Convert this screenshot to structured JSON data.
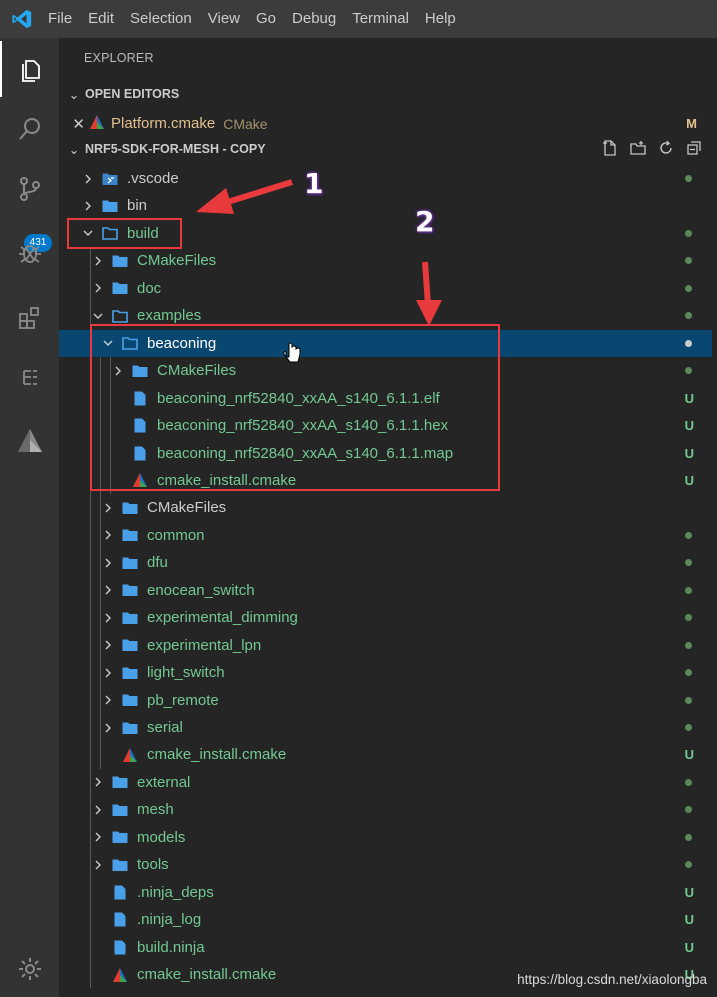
{
  "menu": [
    "File",
    "Edit",
    "Selection",
    "View",
    "Go",
    "Debug",
    "Terminal",
    "Help"
  ],
  "activity_bar": {
    "items": [
      "explorer-icon",
      "search-icon",
      "source-control-icon",
      "debug-icon",
      "extensions-icon",
      "tree-icon",
      "cmake-icon"
    ],
    "scm_badge": "431",
    "bottom": "gear-icon"
  },
  "sidebar": {
    "title": "EXPLORER",
    "open_editors": {
      "header": "OPEN EDITORS",
      "file": "Platform.cmake",
      "desc": "CMake",
      "mark": "M"
    },
    "project": {
      "header": "NRF5-SDK-FOR-MESH - COPY"
    },
    "tree": [
      {
        "label": ".vscode",
        "depth": 0,
        "type": "vsfolder",
        "expanded": false,
        "status": "dot"
      },
      {
        "label": "bin",
        "depth": 0,
        "type": "folder",
        "expanded": false,
        "status": ""
      },
      {
        "label": "build",
        "depth": 0,
        "type": "folder",
        "expanded": true,
        "status": "dot",
        "green": true
      },
      {
        "label": "CMakeFiles",
        "depth": 1,
        "type": "folder",
        "expanded": false,
        "status": "dot",
        "green": true
      },
      {
        "label": "doc",
        "depth": 1,
        "type": "folder",
        "expanded": false,
        "status": "dot",
        "green": true
      },
      {
        "label": "examples",
        "depth": 1,
        "type": "folder",
        "expanded": true,
        "status": "dot",
        "green": true
      },
      {
        "label": "beaconing",
        "depth": 2,
        "type": "folder",
        "expanded": true,
        "status": "dot",
        "selected": true
      },
      {
        "label": "CMakeFiles",
        "depth": 3,
        "type": "folder",
        "expanded": false,
        "status": "dot",
        "green": true
      },
      {
        "label": "beaconing_nrf52840_xxAA_s140_6.1.1.elf",
        "depth": 3,
        "type": "file",
        "status": "U",
        "green": true
      },
      {
        "label": "beaconing_nrf52840_xxAA_s140_6.1.1.hex",
        "depth": 3,
        "type": "file",
        "status": "U",
        "green": true
      },
      {
        "label": "beaconing_nrf52840_xxAA_s140_6.1.1.map",
        "depth": 3,
        "type": "file",
        "status": "U",
        "green": true
      },
      {
        "label": "cmake_install.cmake",
        "depth": 3,
        "type": "cmake",
        "status": "U",
        "green": true
      },
      {
        "label": "CMakeFiles",
        "depth": 2,
        "type": "folder",
        "expanded": false,
        "status": ""
      },
      {
        "label": "common",
        "depth": 2,
        "type": "folder",
        "expanded": false,
        "status": "dot",
        "green": true
      },
      {
        "label": "dfu",
        "depth": 2,
        "type": "folder",
        "expanded": false,
        "status": "dot",
        "green": true
      },
      {
        "label": "enocean_switch",
        "depth": 2,
        "type": "folder",
        "expanded": false,
        "status": "dot",
        "green": true
      },
      {
        "label": "experimental_dimming",
        "depth": 2,
        "type": "folder",
        "expanded": false,
        "status": "dot",
        "green": true
      },
      {
        "label": "experimental_lpn",
        "depth": 2,
        "type": "folder",
        "expanded": false,
        "status": "dot",
        "green": true
      },
      {
        "label": "light_switch",
        "depth": 2,
        "type": "folder",
        "expanded": false,
        "status": "dot",
        "green": true
      },
      {
        "label": "pb_remote",
        "depth": 2,
        "type": "folder",
        "expanded": false,
        "status": "dot",
        "green": true
      },
      {
        "label": "serial",
        "depth": 2,
        "type": "folder",
        "expanded": false,
        "status": "dot",
        "green": true
      },
      {
        "label": "cmake_install.cmake",
        "depth": 2,
        "type": "cmake",
        "status": "U",
        "green": true
      },
      {
        "label": "external",
        "depth": 1,
        "type": "folder",
        "expanded": false,
        "status": "dot",
        "green": true
      },
      {
        "label": "mesh",
        "depth": 1,
        "type": "folder",
        "expanded": false,
        "status": "dot",
        "green": true
      },
      {
        "label": "models",
        "depth": 1,
        "type": "folder",
        "expanded": false,
        "status": "dot",
        "green": true
      },
      {
        "label": "tools",
        "depth": 1,
        "type": "folder",
        "expanded": false,
        "status": "dot",
        "green": true
      },
      {
        "label": ".ninja_deps",
        "depth": 1,
        "type": "file",
        "status": "U",
        "green": true
      },
      {
        "label": ".ninja_log",
        "depth": 1,
        "type": "file",
        "status": "U",
        "green": true
      },
      {
        "label": "build.ninja",
        "depth": 1,
        "type": "file",
        "status": "U",
        "green": true
      },
      {
        "label": "cmake_install.cmake",
        "depth": 1,
        "type": "cmake",
        "status": "U",
        "green": true
      }
    ]
  },
  "annotations": {
    "one": "1",
    "two": "2"
  },
  "watermark": "https://blog.csdn.net/xiaolongba",
  "colors": {
    "accent": "#007acc",
    "selection": "#094771",
    "untracked": "#73c991",
    "modified": "#e2c08d",
    "annotation": "#e8393c"
  }
}
